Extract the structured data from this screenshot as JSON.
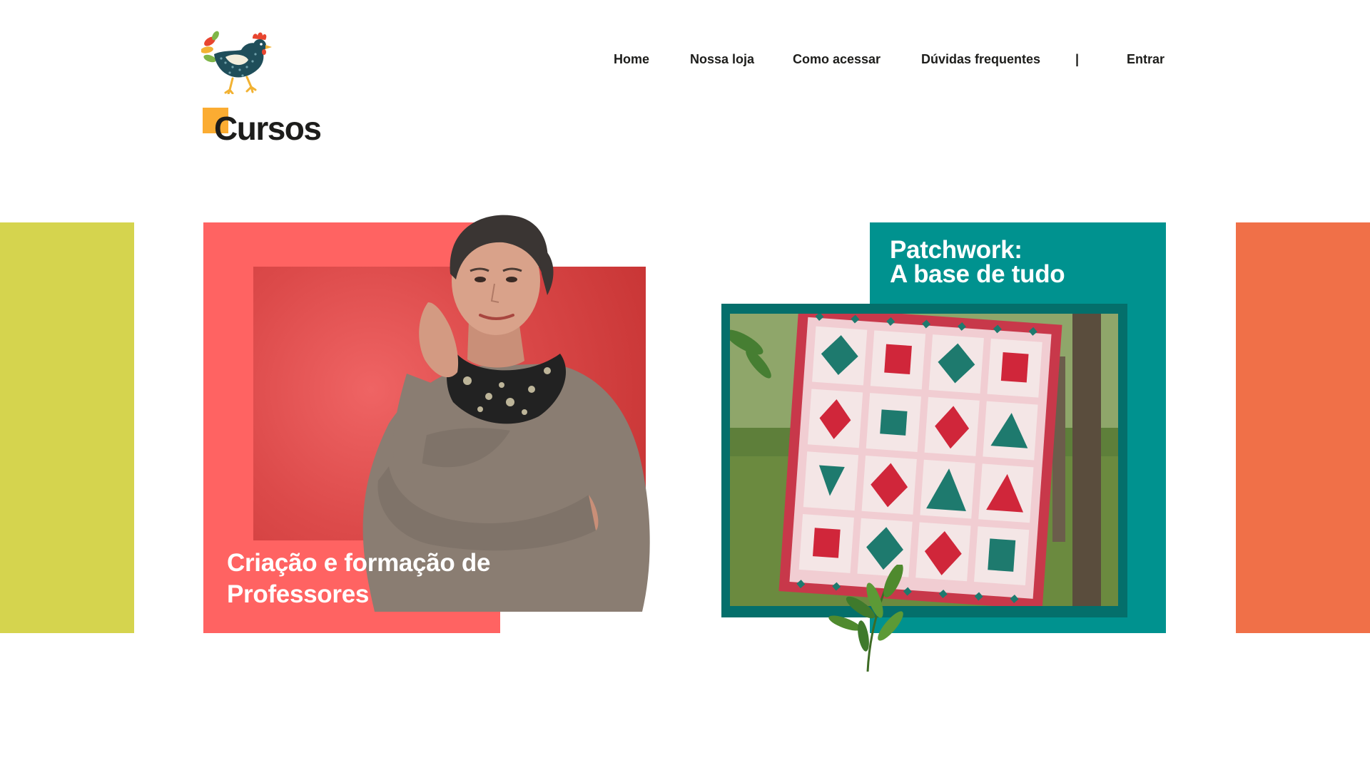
{
  "header": {
    "logo_name": "hen-logo",
    "nav": [
      {
        "label": "Home"
      },
      {
        "label": "Nossa loja"
      },
      {
        "label": "Como acessar"
      },
      {
        "label": "Dúvidas frequentes"
      }
    ],
    "divider": "|",
    "login_label": "Entrar"
  },
  "section": {
    "title": "Cursos"
  },
  "courses": [
    {
      "title": "Criação e formação de Professores",
      "image": "instructor-portrait"
    },
    {
      "title_line1": "Patchwork:",
      "title_line2": "A base de tudo",
      "image": "quilt-photo"
    }
  ],
  "colors": {
    "band_left": "#d5d44e",
    "band_right": "#f07048",
    "card1_bg": "#ff6362",
    "card1_photo_bg": "#d94545",
    "card2_bg": "#00928f",
    "card2_frame": "#046f6b",
    "title_accent": "#fbac32",
    "text_dark": "#1d1d1b"
  }
}
